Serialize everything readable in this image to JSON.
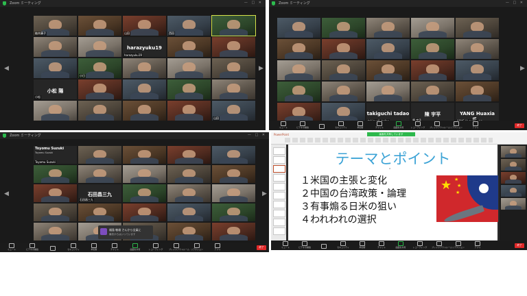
{
  "windows": {
    "top_left_title": "Zoom ミーティング",
    "top_right_title": "Zoom ミーティング",
    "bottom_left_title": "Zoom ミーティング"
  },
  "top_left_names": [
    "",
    "",
    "",
    "",
    "",
    "",
    "",
    "harazyuku19",
    "",
    "",
    "",
    "",
    "",
    "",
    "",
    "小松 陽",
    "",
    "",
    "",
    "",
    "",
    "",
    "",
    "",
    ""
  ],
  "top_left_labels": [
    "柚木康子",
    "",
    "山田",
    "西田",
    "",
    "",
    "",
    "harazyuku19",
    "",
    "",
    "",
    "小日",
    "",
    "",
    "",
    "小松",
    "",
    "",
    "",
    "",
    "",
    "",
    "",
    "",
    "山田"
  ],
  "top_right_names": [
    "",
    "",
    "",
    "",
    "",
    "",
    "",
    "",
    "",
    "",
    "",
    "",
    "",
    "",
    "",
    "",
    "",
    "",
    "",
    "",
    "",
    "",
    "takiguchi tadao",
    "陳 宇平",
    "YANG Huaxia氏..."
  ],
  "top_right_labels": [
    "",
    "",
    "",
    "",
    "",
    "",
    "",
    "",
    "",
    "",
    "",
    "",
    "",
    "",
    "",
    "",
    "",
    "",
    "",
    "",
    "",
    "",
    "takiguchi tadao",
    "陳 宇平",
    "YANG Huaxia..."
  ],
  "bottom_left_names": [
    "Toyomu Suzuki",
    "",
    "",
    "",
    "",
    "",
    "",
    "",
    "",
    "",
    "",
    "石田昌三九",
    "",
    "",
    "",
    "",
    "",
    "",
    "",
    "",
    "",
    "",
    "",
    "",
    ""
  ],
  "bottom_left_labels": [
    "Toyomu Suzuki",
    "",
    "",
    "",
    "",
    "",
    "",
    "",
    "",
    "",
    "",
    "石田昌三九",
    "",
    "",
    "",
    "",
    "",
    "",
    "",
    "",
    "",
    "",
    "",
    "",
    ""
  ],
  "bottom_left_subtitle": "Toyomu Suzuki",
  "chat_popup": {
    "line1": "福島 敏雄 さんから全員に",
    "line2": "最初からはいっています"
  },
  "toolbar_labels": [
    "ミュート",
    "ビデオの開始",
    "",
    "セキュリティ",
    "参加者",
    "チャット",
    "画面を共有",
    "レコーディング",
    "ブレイクアウトルーム",
    "リアクション",
    "アプリ"
  ],
  "end_button": "終了",
  "slide": {
    "ribbon_title": "PowerPoint",
    "share_label": "画面を共有しています",
    "title": "テーマとポイント",
    "points": [
      "１米国の主張と変化",
      "２中国の台湾政策・論理",
      "３有事煽る日米の狙い",
      "４われわれの選択"
    ]
  },
  "colors": {
    "zoom_dark": "#1a1a1a",
    "end_red": "#e02828",
    "share_green": "#2db84c",
    "slide_title_blue": "#3ca3d6",
    "active_speaker_yellow": "#d8e34a"
  }
}
